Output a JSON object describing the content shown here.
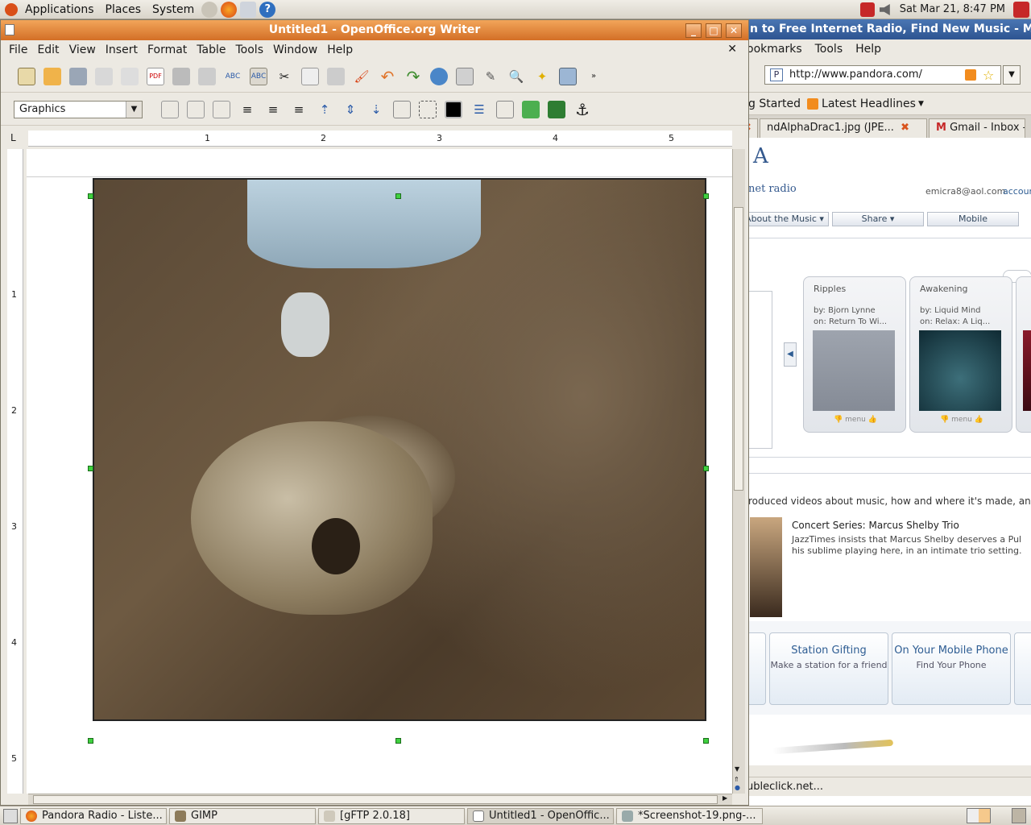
{
  "top_panel": {
    "menus": [
      "Applications",
      "Places",
      "System"
    ],
    "clock": "Sat Mar 21,  8:47 PM"
  },
  "firefox": {
    "title": "n to Free Internet Radio, Find New Music - Mozil",
    "menus": [
      "ookmarks",
      "Tools",
      "Help"
    ],
    "url": "http://www.pandora.com/",
    "bookmarks": [
      "g Started",
      "Latest Headlines"
    ],
    "tabs": [
      "ndAlphaDrac1.jpg (JPE...",
      "Gmail - Inbox -"
    ],
    "pandora": {
      "logo": "A",
      "logo_sub": "net radio",
      "email": "emicra8@aol.com",
      "account": "accoun",
      "nav_buttons": [
        "About the Music",
        "Share",
        "Mobile"
      ],
      "cards": [
        {
          "title": "Ripples",
          "artist": "by: Bjorn Lynne",
          "album": "on: Return To Wi..."
        },
        {
          "title": "Awakening",
          "artist": "by: Liquid Mind",
          "album": "on: Relax: A Liq..."
        }
      ],
      "card_menu": "menu",
      "intro": "roduced videos about music, how and where it's made, and",
      "concert_title": "Concert Series: Marcus Shelby Trio",
      "concert_text": "JazzTimes insists that Marcus Shelby deserves a Pul his sublime playing here, in an intimate trio setting.",
      "promos": [
        {
          "title": "Station Gifting",
          "subtitle": "Make a station for a friend"
        },
        {
          "title": "On Your Mobile Phone",
          "subtitle": "Find Your Phone"
        }
      ]
    },
    "status": "ubleclick.net..."
  },
  "writer": {
    "title": "Untitled1 - OpenOffice.org Writer",
    "menus": [
      "File",
      "Edit",
      "View",
      "Insert",
      "Format",
      "Table",
      "Tools",
      "Window",
      "Help"
    ],
    "style_combo": "Graphics",
    "ruler_h": [
      "1",
      "2",
      "3",
      "4",
      "5"
    ],
    "ruler_v": [
      "1",
      "2",
      "3",
      "4",
      "5"
    ]
  },
  "taskbar": {
    "items": [
      "Pandora Radio - Liste...",
      "GIMP",
      "[gFTP 2.0.18]",
      "Untitled1 - OpenOffic...",
      "*Screenshot-19.png-..."
    ]
  }
}
